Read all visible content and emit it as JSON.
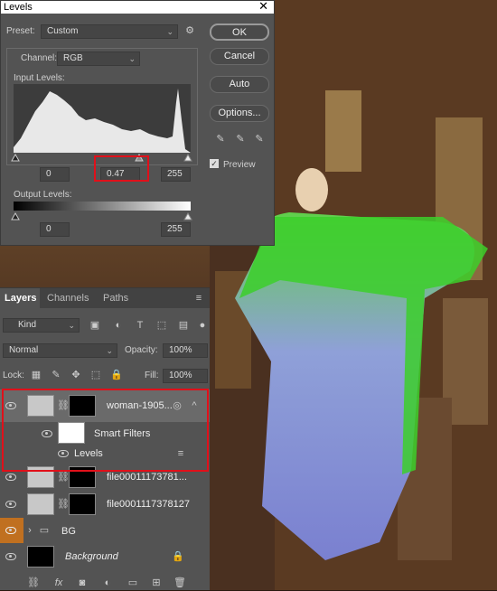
{
  "levels": {
    "title": "Levels",
    "preset_label": "Preset:",
    "preset_value": "Custom",
    "channel_label": "Channel:",
    "channel_value": "RGB",
    "input_levels_label": "Input Levels:",
    "input_black": "0",
    "input_gamma": "0.47",
    "input_white": "255",
    "output_levels_label": "Output Levels:",
    "output_black": "0",
    "output_white": "255",
    "buttons": {
      "ok": "OK",
      "cancel": "Cancel",
      "auto": "Auto",
      "options": "Options..."
    },
    "preview_label": "Preview",
    "preview_checked": true
  },
  "layers_panel": {
    "tabs": [
      "Layers",
      "Channels",
      "Paths"
    ],
    "filter_kind": "Kind",
    "blend_mode": "Normal",
    "opacity_label": "Opacity:",
    "opacity_value": "100%",
    "lock_label": "Lock:",
    "fill_label": "Fill:",
    "fill_value": "100%",
    "layers": [
      {
        "name": "woman-1905..."
      },
      {
        "name": "Smart Filters"
      },
      {
        "name": "Levels"
      },
      {
        "name": "file00011173781..."
      },
      {
        "name": "file0001117378127"
      },
      {
        "name": "BG"
      },
      {
        "name": "Background"
      }
    ]
  },
  "colors": {
    "accent_red": "#e0101a",
    "mask_green": "#3ccf2a",
    "panel_bg": "#535353"
  }
}
